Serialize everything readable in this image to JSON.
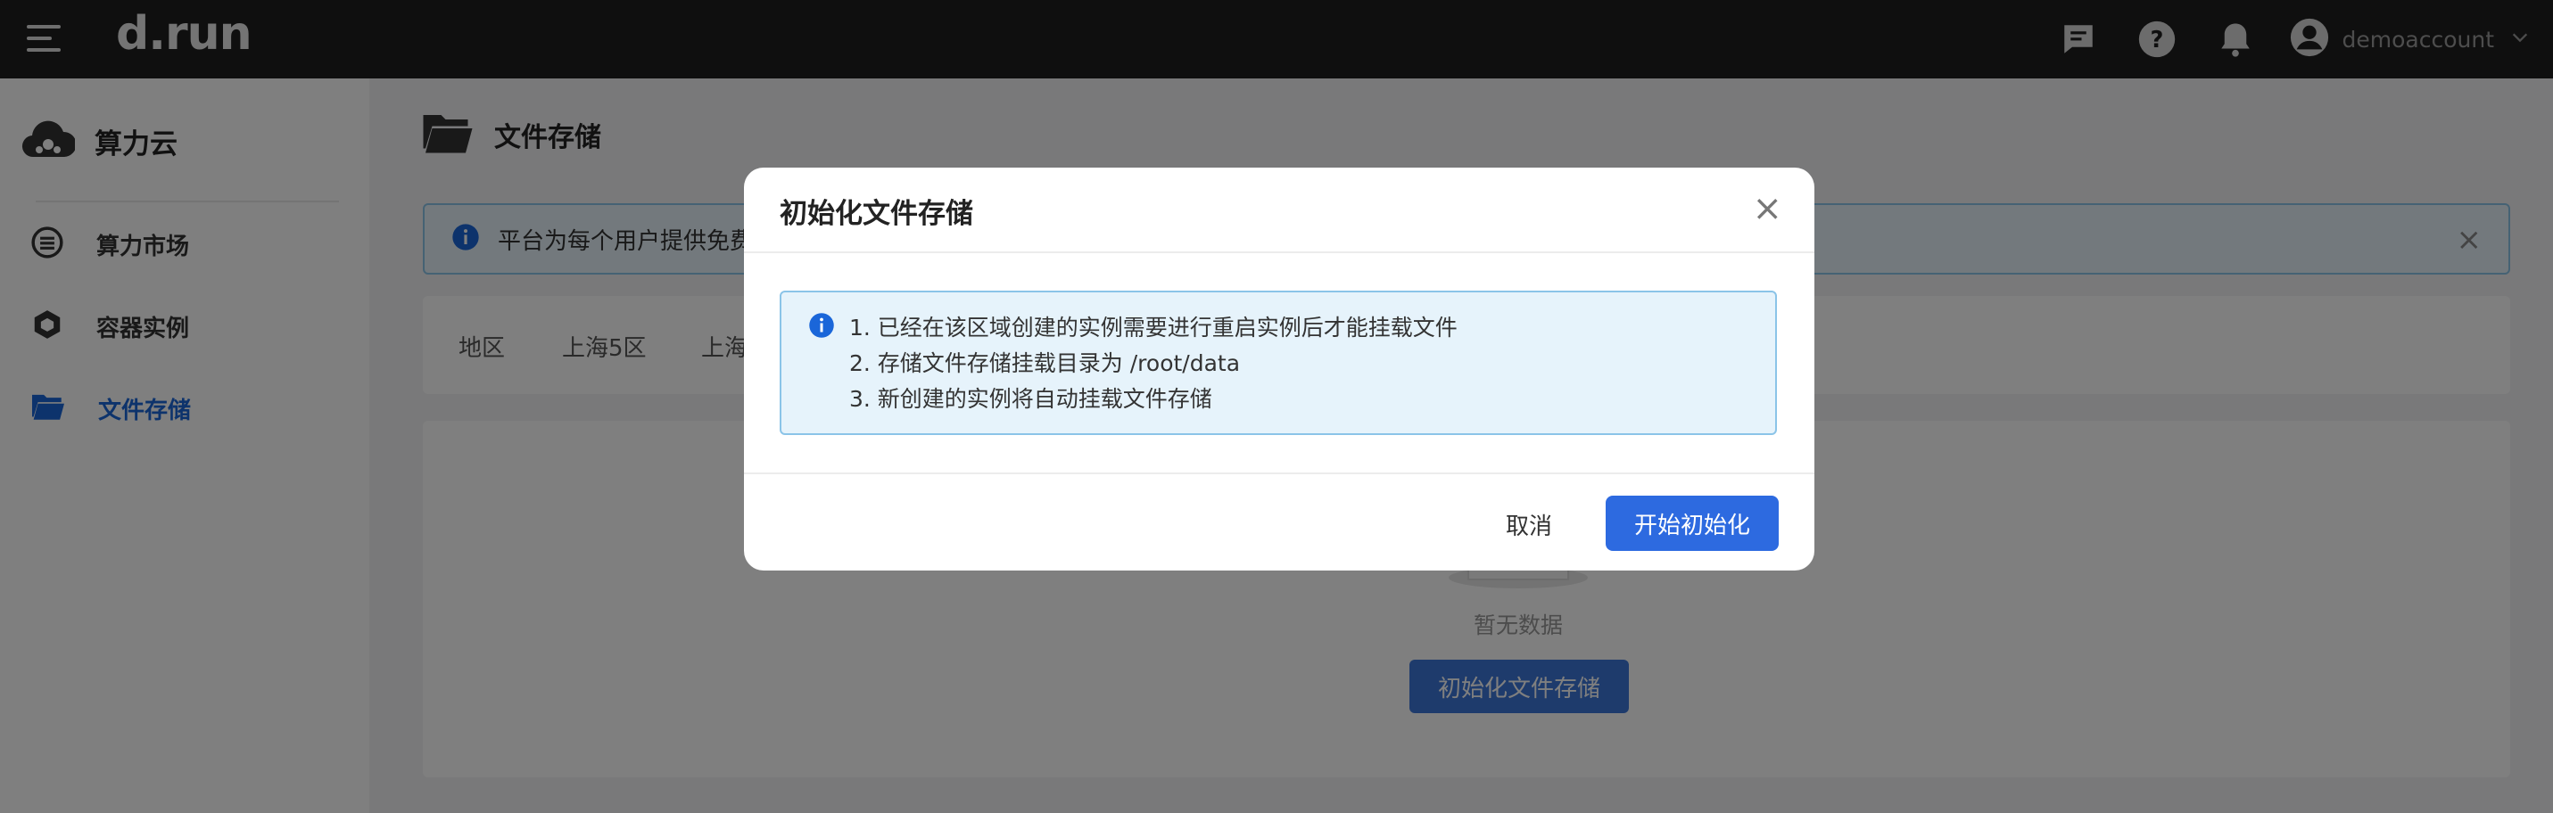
{
  "topbar": {
    "logo": "d.run",
    "username": "demoaccount",
    "icons": [
      "chat-icon",
      "help-icon",
      "bell-icon",
      "user-avatar-icon",
      "chevron-down-icon"
    ]
  },
  "sidebar": {
    "brand": "算力云",
    "items": [
      {
        "label": "算力市场",
        "icon": "market-icon",
        "active": false
      },
      {
        "label": "容器实例",
        "icon": "container-icon",
        "active": false
      },
      {
        "label": "文件存储",
        "icon": "folder-icon",
        "active": true
      }
    ]
  },
  "main": {
    "page_title": "文件存储",
    "alert_text": "平台为每个用户提供免费",
    "regions": [
      "地区",
      "上海5区",
      "上海"
    ],
    "empty_text": "暂无数据",
    "init_button": "初始化文件存储"
  },
  "modal": {
    "title": "初始化文件存储",
    "info_lines": [
      "1. 已经在该区域创建的实例需要进行重启实例后才能挂载文件",
      "2. 存储文件存储挂载目录为 /root/data",
      "3. 新创建的实例将自动挂载文件存储"
    ],
    "cancel_label": "取消",
    "confirm_label": "开始初始化"
  },
  "colors": {
    "topbar_bg": "#1f1f1f",
    "accent": "#2d6ae0",
    "info_bg": "#e6f3fb",
    "info_border": "#8bc4e8",
    "overlay": "rgba(0,0,0,0.5)"
  }
}
